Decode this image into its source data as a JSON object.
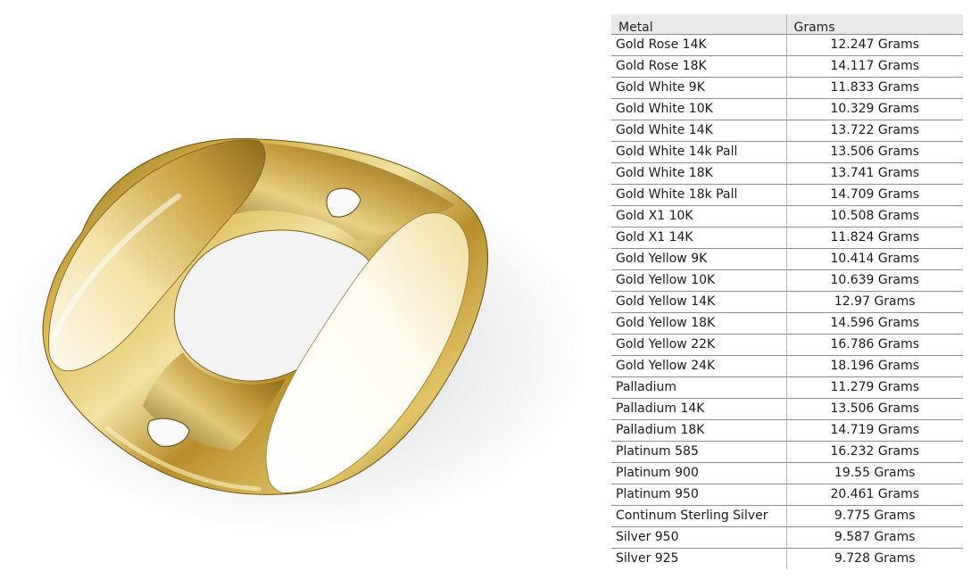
{
  "image": {
    "subject": "ring-render",
    "metal_color": "#c9a43a"
  },
  "table": {
    "headers": {
      "metal": "Metal",
      "grams": "Grams"
    },
    "rows": [
      {
        "metal": "Gold Rose 14K",
        "grams": "12.247 Grams"
      },
      {
        "metal": "Gold Rose 18K",
        "grams": "14.117 Grams"
      },
      {
        "metal": "Gold White 9K",
        "grams": "11.833 Grams"
      },
      {
        "metal": "Gold White 10K",
        "grams": "10.329 Grams"
      },
      {
        "metal": "Gold White 14K",
        "grams": "13.722 Grams"
      },
      {
        "metal": "Gold White 14k Pall",
        "grams": "13.506 Grams"
      },
      {
        "metal": "Gold White 18K",
        "grams": "13.741 Grams"
      },
      {
        "metal": "Gold White 18k Pall",
        "grams": "14.709 Grams"
      },
      {
        "metal": "Gold X1 10K",
        "grams": "10.508 Grams"
      },
      {
        "metal": "Gold X1 14K",
        "grams": "11.824 Grams"
      },
      {
        "metal": "Gold Yellow 9K",
        "grams": "10.414 Grams"
      },
      {
        "metal": "Gold Yellow 10K",
        "grams": "10.639 Grams"
      },
      {
        "metal": "Gold Yellow 14K",
        "grams": "12.97 Grams"
      },
      {
        "metal": "Gold Yellow 18K",
        "grams": "14.596 Grams"
      },
      {
        "metal": "Gold Yellow 22K",
        "grams": "16.786 Grams"
      },
      {
        "metal": "Gold Yellow 24K",
        "grams": "18.196 Grams"
      },
      {
        "metal": "Palladium",
        "grams": "11.279 Grams"
      },
      {
        "metal": "Palladium 14K",
        "grams": "13.506 Grams"
      },
      {
        "metal": "Palladium 18K",
        "grams": "14.719 Grams"
      },
      {
        "metal": "Platinum 585",
        "grams": "16.232 Grams"
      },
      {
        "metal": "Platinum 900",
        "grams": "19.55 Grams"
      },
      {
        "metal": "Platinum 950",
        "grams": "20.461 Grams"
      },
      {
        "metal": "Continum Sterling Silver",
        "grams": "9.775 Grams"
      },
      {
        "metal": "Silver 950",
        "grams": "9.587 Grams"
      },
      {
        "metal": "Silver 925",
        "grams": "9.728 Grams"
      }
    ]
  }
}
